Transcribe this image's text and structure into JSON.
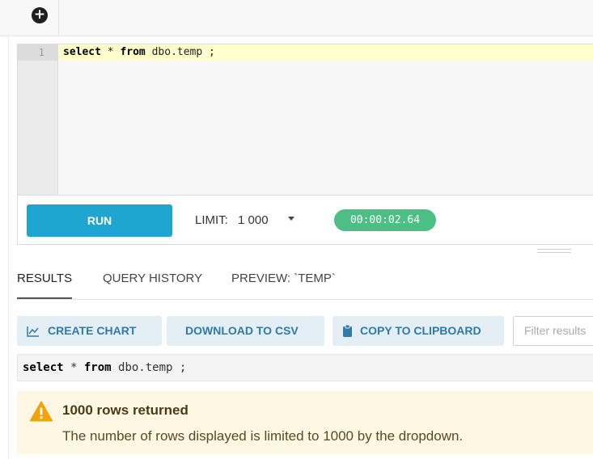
{
  "tabstrip": {
    "add_icon": "plus-circle-icon",
    "add_symbol": "+"
  },
  "editor": {
    "line_number": "1",
    "tokens": [
      "select",
      " * ",
      "from",
      " dbo.temp ;"
    ]
  },
  "runbar": {
    "run_label": "RUN",
    "limit_label": "LIMIT:",
    "limit_value": "1 000",
    "dropdown_icon": "caret-down-icon",
    "elapsed": "00:00:02.64",
    "timer_color": "#4cbf85",
    "run_color": "#1ea5d0"
  },
  "tabs": [
    {
      "label": "RESULTS",
      "active": true
    },
    {
      "label": "QUERY HISTORY",
      "active": false
    },
    {
      "label": "PREVIEW: `TEMP`",
      "active": false
    }
  ],
  "actions": {
    "create_chart": {
      "label": "CREATE CHART",
      "icon": "line-chart-icon"
    },
    "download_csv": {
      "label": "DOWNLOAD TO CSV"
    },
    "copy_clipboard": {
      "label": "COPY TO CLIPBOARD",
      "icon": "clipboard-icon"
    },
    "filter_placeholder": "Filter results",
    "button_color": "#e4eff5",
    "text_color": "#2f7aa6"
  },
  "echo": {
    "tokens": [
      "select",
      " * ",
      "from",
      " dbo.temp ;"
    ]
  },
  "warning": {
    "icon": "warning-triangle-icon",
    "title": "1000 rows returned",
    "text": "The number of rows displayed is limited to 1000 by the dropdown.",
    "icon_color": "#f0a30a",
    "background": "#fdf7e3"
  }
}
